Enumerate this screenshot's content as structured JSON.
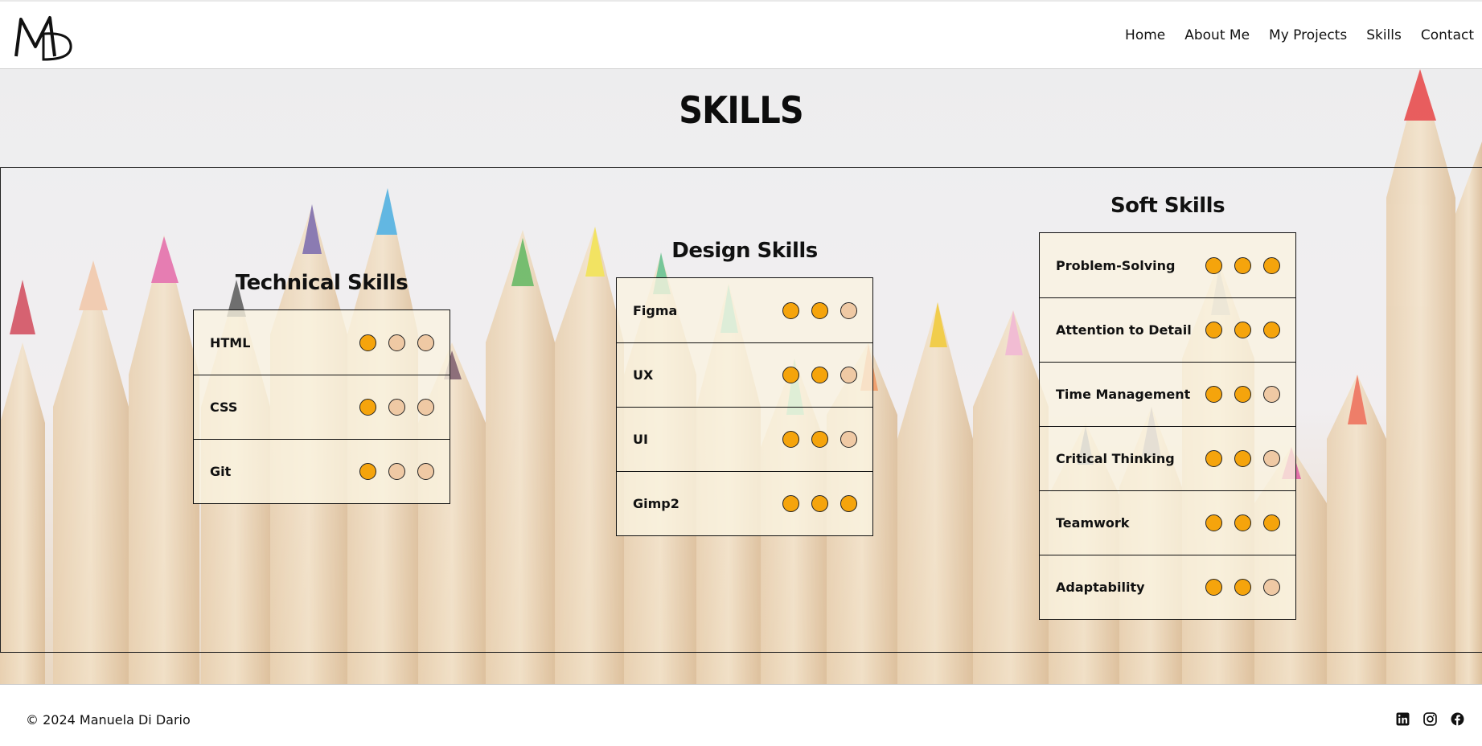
{
  "header": {
    "logo_text": "MD",
    "nav": [
      {
        "label": "Home"
      },
      {
        "label": "About Me"
      },
      {
        "label": "My Projects"
      },
      {
        "label": "Skills"
      },
      {
        "label": "Contact"
      }
    ]
  },
  "page": {
    "title": "SKILLS"
  },
  "skill_groups": [
    {
      "title": "Technical Skills",
      "skills": [
        {
          "name": "HTML",
          "level": 1,
          "max": 3
        },
        {
          "name": "CSS",
          "level": 1,
          "max": 3
        },
        {
          "name": "Git",
          "level": 1,
          "max": 3
        }
      ]
    },
    {
      "title": "Design Skills",
      "skills": [
        {
          "name": "Figma",
          "level": 2,
          "max": 3
        },
        {
          "name": "UX",
          "level": 2,
          "max": 3
        },
        {
          "name": "UI",
          "level": 2,
          "max": 3
        },
        {
          "name": "Gimp2",
          "level": 3,
          "max": 3
        }
      ]
    },
    {
      "title": "Soft Skills",
      "skills": [
        {
          "name": "Problem-Solving",
          "level": 3,
          "max": 3
        },
        {
          "name": "Attention to Detail",
          "level": 3,
          "max": 3
        },
        {
          "name": "Time Management",
          "level": 2,
          "max": 3
        },
        {
          "name": "Critical Thinking",
          "level": 2,
          "max": 3
        },
        {
          "name": "Teamwork",
          "level": 3,
          "max": 3
        },
        {
          "name": "Adaptability",
          "level": 2,
          "max": 3
        }
      ]
    }
  ],
  "footer": {
    "copyright": "© 2024 Manuela Di Dario",
    "socials": [
      {
        "icon": "linkedin-icon"
      },
      {
        "icon": "instagram-icon"
      },
      {
        "icon": "facebook-icon"
      }
    ]
  },
  "colors": {
    "dot_filled": "#f5a40c",
    "dot_empty": "#efc9a4"
  }
}
